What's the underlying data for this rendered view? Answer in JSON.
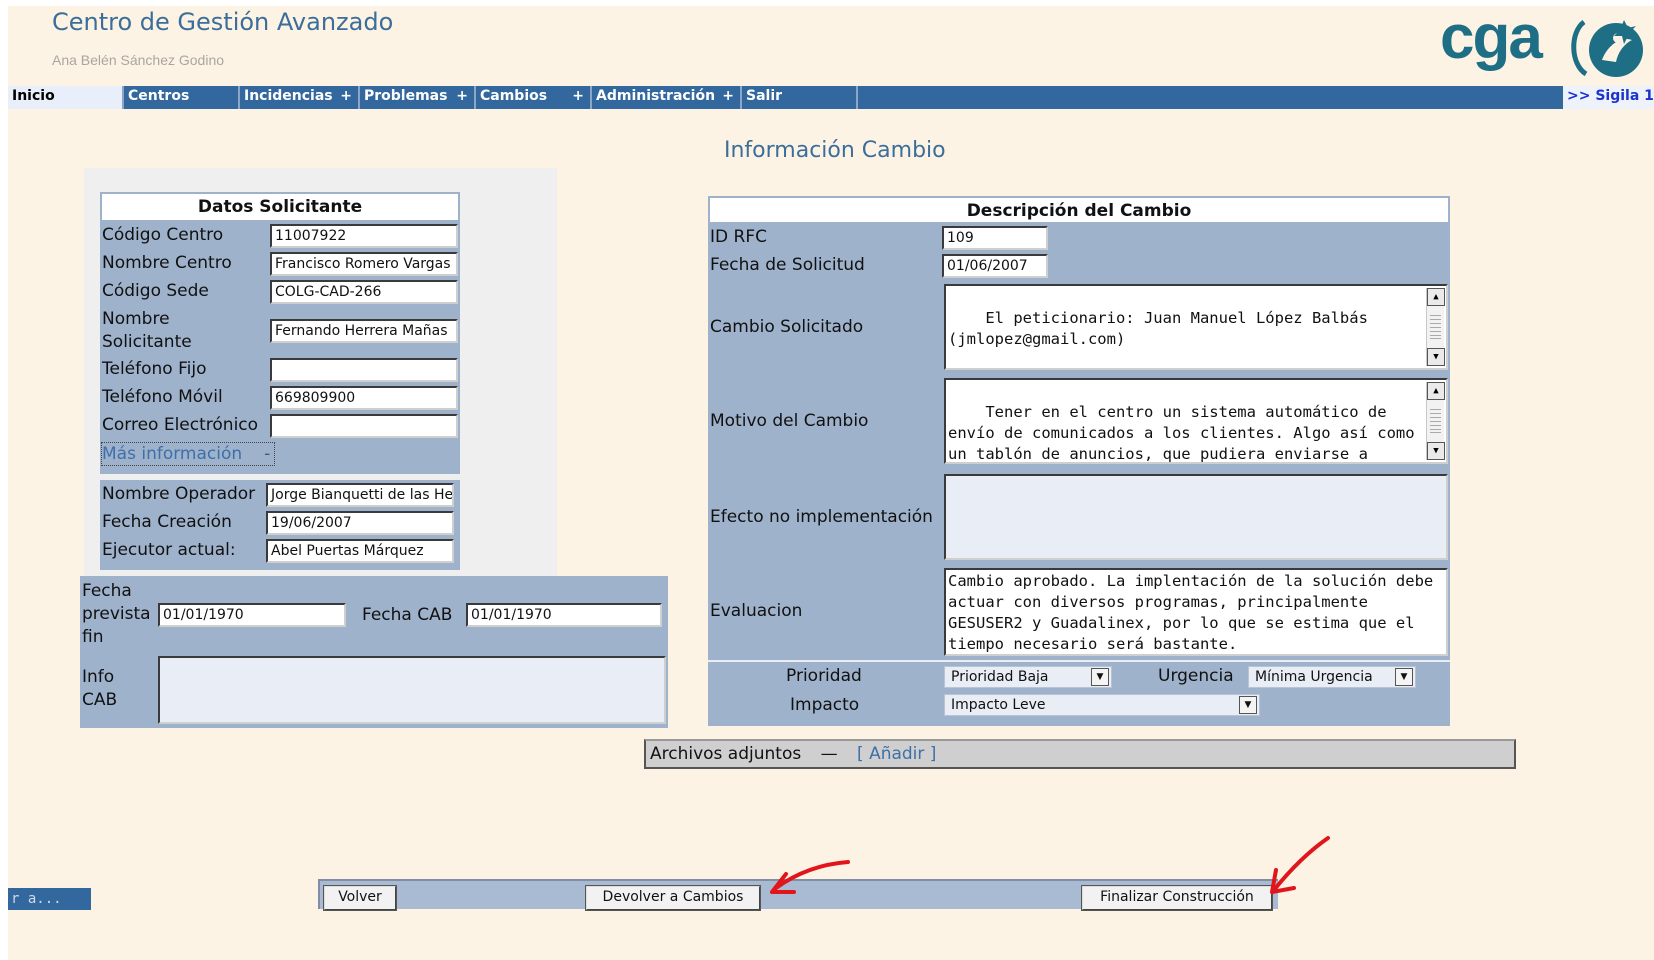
{
  "header": {
    "app_title": "Centro de Gestión Avanzado",
    "user_name": "Ana Belén Sánchez Godino",
    "logo_text": "cga"
  },
  "menu": {
    "items": [
      {
        "label": "Inicio",
        "plus": ""
      },
      {
        "label": "Centros",
        "plus": ""
      },
      {
        "label": "Incidencias",
        "plus": "+"
      },
      {
        "label": "Problemas",
        "plus": "+"
      },
      {
        "label": "Cambios",
        "plus": "+"
      },
      {
        "label": "Administración",
        "plus": "+"
      },
      {
        "label": "Salir",
        "plus": ""
      }
    ],
    "extra": ">> Sigila 1"
  },
  "page_title": "Información Cambio",
  "solicitante": {
    "heading": "Datos Solicitante",
    "fields": [
      {
        "label": "Código Centro",
        "value": "11007922"
      },
      {
        "label": "Nombre Centro",
        "value": "Francisco Romero Vargas"
      },
      {
        "label": "Código Sede",
        "value": "COLG-CAD-266"
      },
      {
        "label": "Nombre Solicitante",
        "value": "Fernando Herrera Mañas"
      },
      {
        "label": "Teléfono Fijo",
        "value": ""
      },
      {
        "label": "Teléfono Móvil",
        "value": "669809900"
      },
      {
        "label": "Correo Electrónico",
        "value": ""
      }
    ],
    "more_info": "Más información",
    "more_info_toggle": "-"
  },
  "operador": {
    "fields": [
      {
        "label": "Nombre Operador",
        "value": "Jorge Bianquetti de las Heras"
      },
      {
        "label": "Fecha Creación",
        "value": "19/06/2007"
      },
      {
        "label": "Ejecutor actual:",
        "value": "Abel Puertas Márquez"
      }
    ]
  },
  "cab": {
    "fecha_prevista_label": "Fecha prevista fin",
    "fecha_prevista_value": "01/01/1970",
    "fecha_cab_label": "Fecha CAB",
    "fecha_cab_value": "01/01/1970",
    "info_cab_label": "Info CAB",
    "info_cab_value": ""
  },
  "descripcion": {
    "heading": "Descripción del Cambio",
    "id_rfc_label": "ID RFC",
    "id_rfc_value": "109",
    "fecha_solicitud_label": "Fecha de Solicitud",
    "fecha_solicitud_value": "01/06/2007",
    "cambio_solicitado_label": "Cambio Solicitado",
    "cambio_solicitado_value": "El peticionario: Juan Manuel López Balbás (jmlopez@gmail.com)\n\nNecesitamos un sistema de mensajería que muestre",
    "motivo_label": "Motivo del Cambio",
    "motivo_value": "Tener en el centro un sistema automático de envío de comunicados a los clientes. Algo así como un tablón de anuncios, que pudiera enviarse a grupos de usuarios. Creo que esta herramienta sería útil",
    "efecto_label": "Efecto no implementación",
    "efecto_value": "",
    "evaluacion_label": "Evaluacion",
    "evaluacion_value": "Cambio aprobado. La implentación de la solución debe actuar con diversos programas, principalmente GESUSER2 y Guadalinex, por lo que se estima que el tiempo necesario será bastante.",
    "prioridad_label": "Prioridad",
    "prioridad_value": "Prioridad Baja",
    "urgencia_label": "Urgencia",
    "urgencia_value": "Mínima Urgencia",
    "impacto_label": "Impacto",
    "impacto_value": "Impacto Leve"
  },
  "attachments": {
    "label": "Archivos adjuntos",
    "separator": "—",
    "add_link": "[ Añadir ]"
  },
  "footer": {
    "volver": "Volver",
    "devolver": "Devolver a Cambios",
    "finalizar": "Finalizar Construcción"
  },
  "status_text": "r a...",
  "annotation_color": "#e0161b"
}
